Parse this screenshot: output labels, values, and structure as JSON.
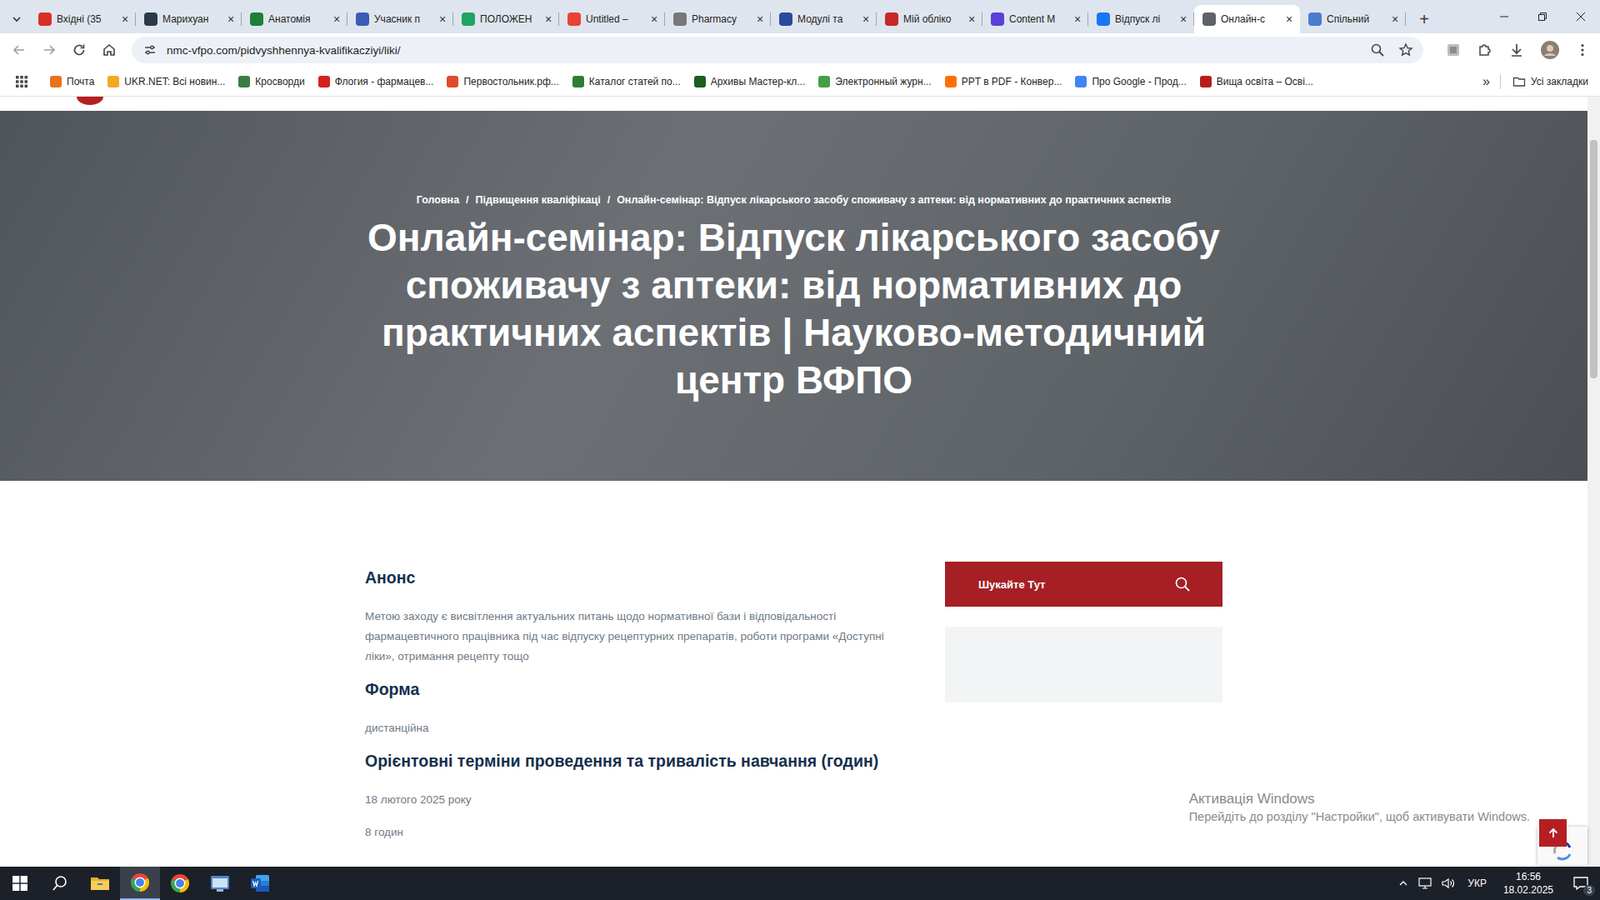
{
  "browser": {
    "tabs": [
      {
        "label": "Вхідні (35",
        "selected": false,
        "color": "#d93025"
      },
      {
        "label": "Марихуан",
        "selected": false,
        "color": "#2b3a4a"
      },
      {
        "label": "Анатомія",
        "selected": false,
        "color": "#1e7f3a"
      },
      {
        "label": "Учасник п",
        "selected": false,
        "color": "#3b5bb5"
      },
      {
        "label": "ПОЛОЖЕН",
        "selected": false,
        "color": "#1fa463"
      },
      {
        "label": "Untitled –",
        "selected": false,
        "color": "#e94235"
      },
      {
        "label": "Pharmacy",
        "selected": false,
        "color": "#777777"
      },
      {
        "label": "Модулі та",
        "selected": false,
        "color": "#2a4a9b"
      },
      {
        "label": "Мій обліко",
        "selected": false,
        "color": "#c62828"
      },
      {
        "label": "Content M",
        "selected": false,
        "color": "#5b3fd6"
      },
      {
        "label": "Відпуск лі",
        "selected": false,
        "color": "#1877f2"
      },
      {
        "label": "Онлайн-с",
        "selected": true,
        "color": "#5f6368"
      },
      {
        "label": "Спільний",
        "selected": false,
        "color": "#4a7bd0"
      }
    ],
    "tab_close": "×",
    "new_tab": "+",
    "url": "nmc-vfpo.com/pidvyshhennya-kvalifikacziyi/liki/",
    "bookmarks": [
      {
        "label": "Почта",
        "color": "#e8711a"
      },
      {
        "label": "UKR.NET: Всі новин...",
        "color": "#f5a623"
      },
      {
        "label": "Кросворди",
        "color": "#3a7d44"
      },
      {
        "label": "Флогия - фармацев...",
        "color": "#d62020"
      },
      {
        "label": "Первостольник.рф...",
        "color": "#e04a2a"
      },
      {
        "label": "Каталог статей по...",
        "color": "#2e7d32"
      },
      {
        "label": "Архивы Мастер-кл...",
        "color": "#1b5e20"
      },
      {
        "label": "Электронный журн...",
        "color": "#43a047"
      },
      {
        "label": "PPT в PDF - Конвер...",
        "color": "#ff6f00"
      },
      {
        "label": "Про Google - Прод...",
        "color": "#4285f4"
      },
      {
        "label": "Вища освіта – Осві...",
        "color": "#b71c1c"
      }
    ],
    "bookmarks_more": "»",
    "all_bookmarks": "Усі закладки"
  },
  "page": {
    "breadcrumbs": [
      "Головна",
      "Підвищення кваліфікаці",
      "Онлайн-семінар: Відпуск лікарського засобу споживачу з аптеки: від нормативних до практичних аспектів"
    ],
    "separator": "/",
    "title": "Онлайн-семінар: Відпуск лікарського засобу споживачу з аптеки: від нормативних до практичних аспектів | Науково-методичний центр ВФПО",
    "sections": [
      {
        "heading": "Анонс",
        "paragraphs": [
          "Метою заходу є висвітлення актуальних питань щодо нормативної бази і відповідальності фармацевтичного працівника під час відпуску рецептурних препаратів, роботи програми «Доступні ліки», отримання рецепту тощо"
        ]
      },
      {
        "heading": "Форма",
        "paragraphs": [
          "дистанційна"
        ]
      },
      {
        "heading": "Орієнтовні терміни проведення та тривалість навчання (годин)",
        "paragraphs": [
          "18 лютого 2025 року",
          "8 годин"
        ]
      }
    ],
    "search": {
      "placeholder": "Шукайте Тут"
    },
    "scrollbar": {
      "offset": 0.056,
      "size": 0.31
    }
  },
  "watermark": {
    "title": "Активація Windows",
    "subtitle": "Перейдіть до розділу \"Настройки\", щоб активувати Windows."
  },
  "taskbar": {
    "apps": [
      {
        "kind": "start",
        "active": false
      },
      {
        "kind": "search",
        "active": false
      },
      {
        "kind": "explorer",
        "active": false
      },
      {
        "kind": "chrome",
        "active": true
      },
      {
        "kind": "chrome",
        "active": false
      },
      {
        "kind": "app",
        "active": false
      },
      {
        "kind": "word",
        "active": false
      }
    ],
    "language": "УКР",
    "time": "16:56",
    "date": "18.02.2025",
    "notifications": "3"
  }
}
